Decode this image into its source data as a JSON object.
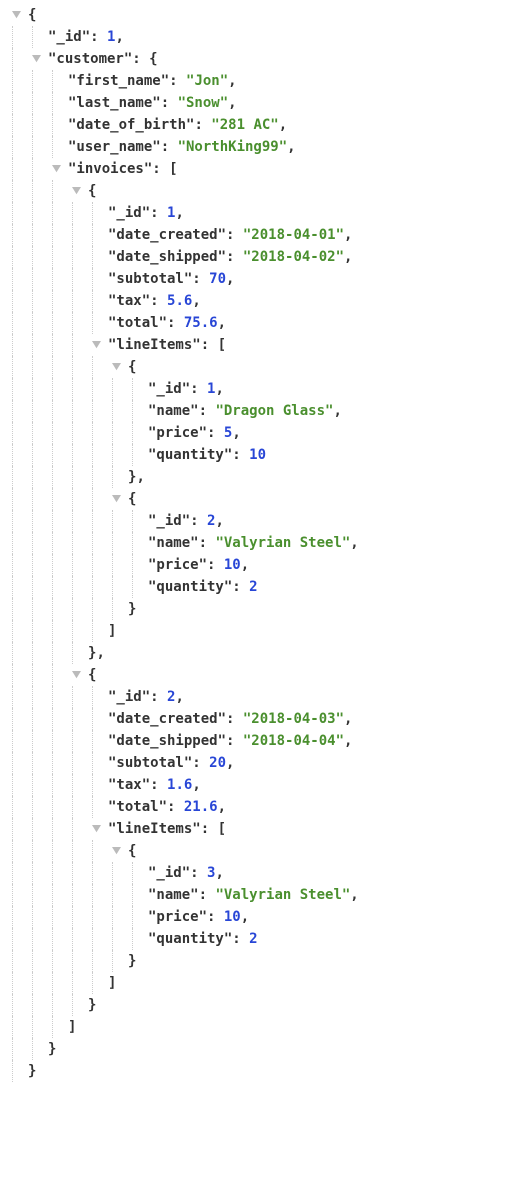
{
  "json": {
    "_id": 1,
    "customer": {
      "first_name": "Jon",
      "last_name": "Snow",
      "date_of_birth": "281 AC",
      "user_name": "NorthKing99",
      "invoices": [
        {
          "_id": 1,
          "date_created": "2018-04-01",
          "date_shipped": "2018-04-02",
          "subtotal": 70,
          "tax": 5.6,
          "total": 75.6,
          "lineItems": [
            {
              "_id": 1,
              "name": "Dragon Glass",
              "price": 5,
              "quantity": 10
            },
            {
              "_id": 2,
              "name": "Valyrian Steel",
              "price": 10,
              "quantity": 2
            }
          ]
        },
        {
          "_id": 2,
          "date_created": "2018-04-03",
          "date_shipped": "2018-04-04",
          "subtotal": 20,
          "tax": 1.6,
          "total": 21.6,
          "lineItems": [
            {
              "_id": 3,
              "name": "Valyrian Steel",
              "price": 10,
              "quantity": 2
            }
          ]
        }
      ]
    }
  }
}
